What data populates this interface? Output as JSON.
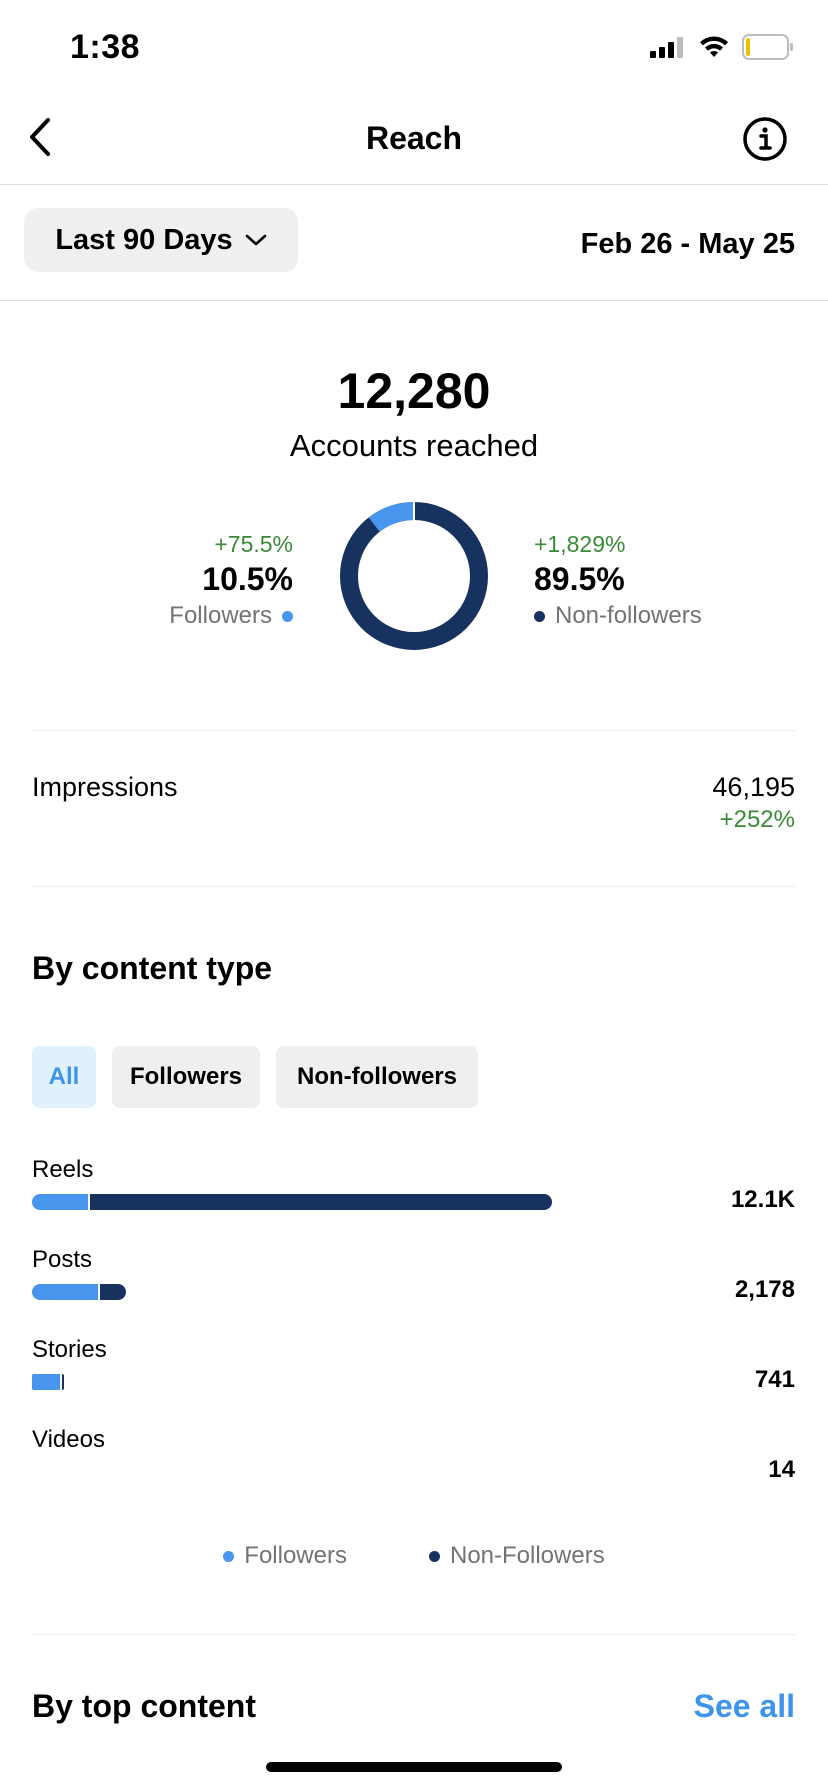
{
  "status_bar": {
    "time": "1:38"
  },
  "header": {
    "title": "Reach"
  },
  "range": {
    "label": "Last 90 Days",
    "dates": "Feb 26 - May 25"
  },
  "summary": {
    "total": "12,280",
    "total_label": "Accounts reached",
    "followers": {
      "delta": "+75.5%",
      "pct": "10.5%",
      "label": "Followers",
      "share": 0.105
    },
    "non_followers": {
      "delta": "+1,829%",
      "pct": "89.5%",
      "label": "Non-followers",
      "share": 0.895
    }
  },
  "impressions": {
    "label": "Impressions",
    "value": "46,195",
    "delta": "+252%"
  },
  "content_type": {
    "title": "By content type",
    "tabs": [
      {
        "label": "All",
        "active": true
      },
      {
        "label": "Followers",
        "active": false
      },
      {
        "label": "Non-followers",
        "active": false
      }
    ],
    "rows": [
      {
        "label": "Reels",
        "value": "12.1K",
        "followers_value": 1300,
        "non_followers_value": 10800
      },
      {
        "label": "Posts",
        "value": "2,178",
        "followers_value": 1560,
        "non_followers_value": 618
      },
      {
        "label": "Stories",
        "value": "741",
        "followers_value": 700,
        "non_followers_value": 41
      },
      {
        "label": "Videos",
        "value": "14",
        "followers_value": 0,
        "non_followers_value": 0
      }
    ],
    "legend": {
      "followers": "Followers",
      "non_followers": "Non-Followers"
    }
  },
  "top_content": {
    "title": "By top content",
    "see_all": "See all"
  },
  "colors": {
    "followers": "#4795ec",
    "non_followers": "#17325f",
    "positive": "#3b8a37",
    "link": "#3d94ea"
  }
}
